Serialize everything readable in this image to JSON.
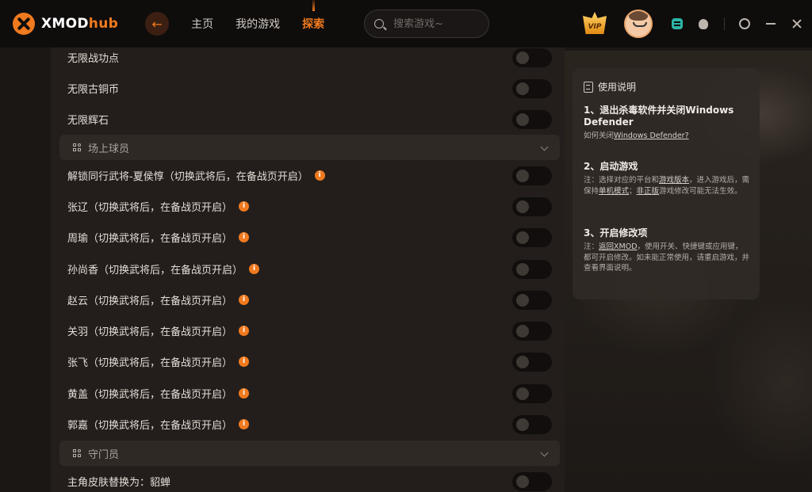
{
  "app": {
    "brand_main": "XMOD",
    "brand_accent": "hub",
    "accent_color": "#f07a1f"
  },
  "nav": {
    "items": [
      {
        "label": "主页",
        "active": false
      },
      {
        "label": "我的游戏",
        "active": false
      },
      {
        "label": "探索",
        "active": true
      }
    ],
    "search_placeholder": "搜索游戏~",
    "vip_label": "VIP"
  },
  "cheats": {
    "top_items": [
      {
        "label": "无限战功点",
        "has_info": false,
        "enabled": false
      },
      {
        "label": "无限古铜币",
        "has_info": false,
        "enabled": false
      },
      {
        "label": "无限辉石",
        "has_info": false,
        "enabled": false
      }
    ],
    "section_players": {
      "title": "场上球员",
      "items": [
        {
          "label": "解锁同行武将-夏侯惇（切换武将后，在备战页开启）",
          "has_info": true,
          "enabled": false
        },
        {
          "label": "张辽（切换武将后，在备战页开启）",
          "has_info": true,
          "enabled": false
        },
        {
          "label": "周瑜（切换武将后，在备战页开启）",
          "has_info": true,
          "enabled": false
        },
        {
          "label": "孙尚香（切换武将后，在备战页开启）",
          "has_info": true,
          "enabled": false
        },
        {
          "label": "赵云（切换武将后，在备战页开启）",
          "has_info": true,
          "enabled": false
        },
        {
          "label": "关羽（切换武将后，在备战页开启）",
          "has_info": true,
          "enabled": false
        },
        {
          "label": "张飞（切换武将后，在备战页开启）",
          "has_info": true,
          "enabled": false
        },
        {
          "label": "黄盖（切换武将后，在备战页开启）",
          "has_info": true,
          "enabled": false
        },
        {
          "label": "郭嘉（切换武将后，在备战页开启）",
          "has_info": true,
          "enabled": false
        }
      ]
    },
    "section_keeper": {
      "title": "守门员",
      "items": [
        {
          "label": "主角皮肤替换为：貂蝉",
          "has_info": false,
          "enabled": false
        }
      ]
    },
    "info_glyph": "i"
  },
  "instructions": {
    "title": "使用说明",
    "step1": {
      "title": "1、退出杀毒软件并关闭Windows Defender",
      "link_prefix": "如何关闭",
      "link": "Windows Defender?"
    },
    "step2": {
      "title": "2、启动游戏",
      "n1": "注：选择对应的平台和",
      "link1": "游戏版本",
      "n2": "，进入游戏后，需保持",
      "link2": "单机模式",
      "n3": "；",
      "link3": "非正版",
      "n4": "游戏修改可能无法生效。"
    },
    "step3": {
      "title": "3、开启修改项",
      "n1": "注：",
      "link1": "返回XMOD",
      "n2": "，使用开关、快捷键或应用键，都可开启修改。如未能正常使用，请重启游戏，并查看界面说明。"
    }
  }
}
